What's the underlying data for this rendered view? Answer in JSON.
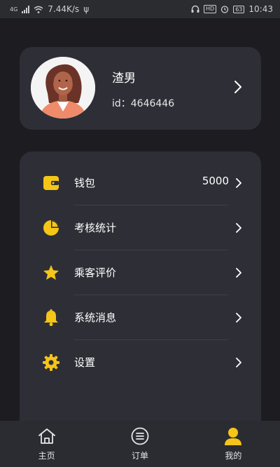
{
  "status_bar": {
    "network": "4G",
    "speed": "7.44K/s",
    "usb": "ψ",
    "hd": "HD",
    "battery": "63",
    "time": "10:43"
  },
  "profile": {
    "name": "渣男",
    "id_text": "id：4646446"
  },
  "menu": {
    "items": [
      {
        "label": "钱包",
        "value": "5000",
        "icon": "wallet-icon"
      },
      {
        "label": "考核统计",
        "icon": "pie-chart-icon"
      },
      {
        "label": "乘客评价",
        "icon": "star-icon"
      },
      {
        "label": "系统消息",
        "icon": "bell-icon"
      },
      {
        "label": "设置",
        "icon": "gear-icon"
      }
    ]
  },
  "tabs": [
    {
      "label": "主页",
      "icon": "home-icon",
      "active": false
    },
    {
      "label": "订单",
      "icon": "list-icon",
      "active": false
    },
    {
      "label": "我的",
      "icon": "user-icon",
      "active": true
    }
  ],
  "colors": {
    "background": "#1c1c21",
    "card": "#2e2f36",
    "accent": "#f5c518",
    "text": "#ffffff"
  }
}
